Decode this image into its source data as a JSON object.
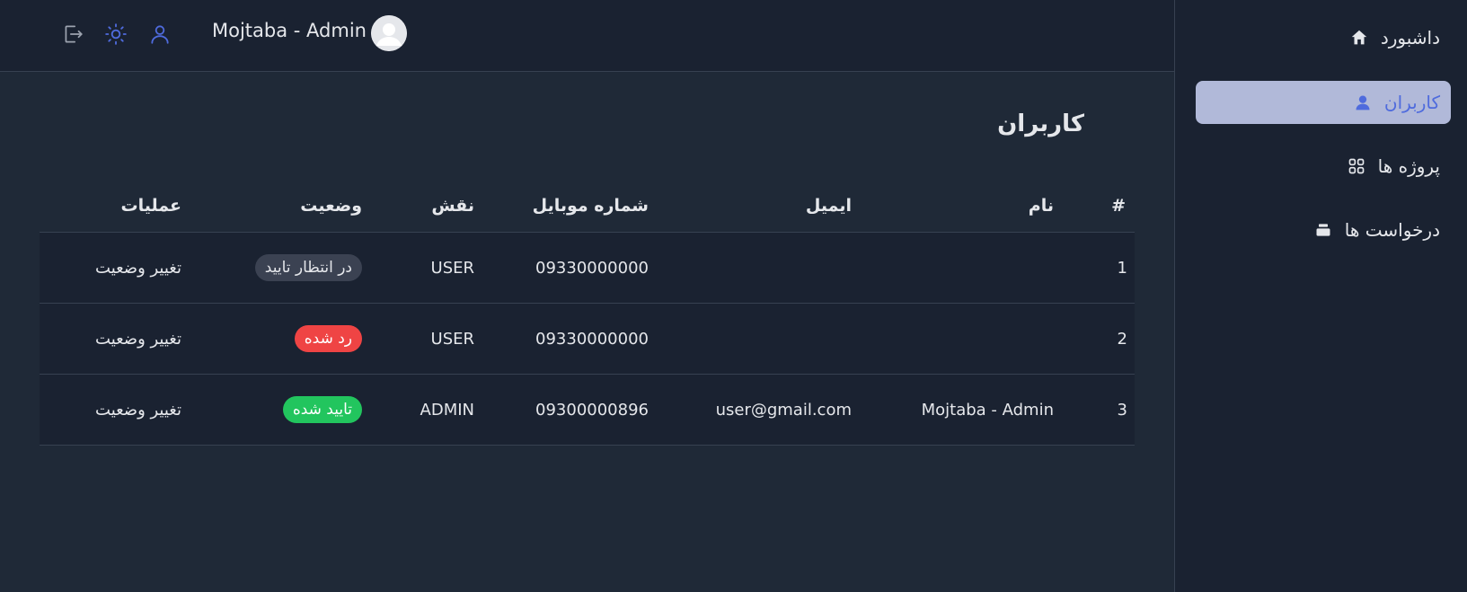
{
  "header": {
    "user_name": "Mojtaba - Admin",
    "icons": [
      "logout-icon",
      "sun-icon",
      "user-icon"
    ],
    "accent": "#4f6bdd"
  },
  "sidebar": {
    "items": [
      {
        "label": "داشبورد",
        "icon": "home-icon",
        "active": false
      },
      {
        "label": "کاربران",
        "icon": "user-icon",
        "active": true
      },
      {
        "label": "پروژه ها",
        "icon": "grid-icon",
        "active": false
      },
      {
        "label": "درخواست ها",
        "icon": "stack-icon",
        "active": false
      }
    ]
  },
  "main": {
    "title": "کاربران",
    "table": {
      "headers": {
        "index": "#",
        "name": "نام",
        "email": "ایمیل",
        "mobile": "شماره موبایل",
        "role": "نقش",
        "status": "وضعیت",
        "actions": "عملیات"
      },
      "rows": [
        {
          "index": "1",
          "name": "",
          "email": "",
          "mobile": "09330000000",
          "role": "USER",
          "status": "در انتظار تایید",
          "status_type": "pending",
          "action": "تغییر وضعیت"
        },
        {
          "index": "2",
          "name": "",
          "email": "",
          "mobile": "09330000000",
          "role": "USER",
          "status": "رد شده",
          "status_type": "rejected",
          "action": "تغییر وضعیت"
        },
        {
          "index": "3",
          "name": "Mojtaba - Admin",
          "email": "user@gmail.com",
          "mobile": "09300000896",
          "role": "ADMIN",
          "status": "تایید شده",
          "status_type": "approved",
          "action": "تغییر وضعیت"
        }
      ]
    }
  },
  "colors": {
    "background": "#1f2937",
    "panel": "#1a2231",
    "active_nav": "#b1b9d9",
    "pending": "#3b4252",
    "rejected": "#ef4444",
    "approved": "#22c55e"
  }
}
